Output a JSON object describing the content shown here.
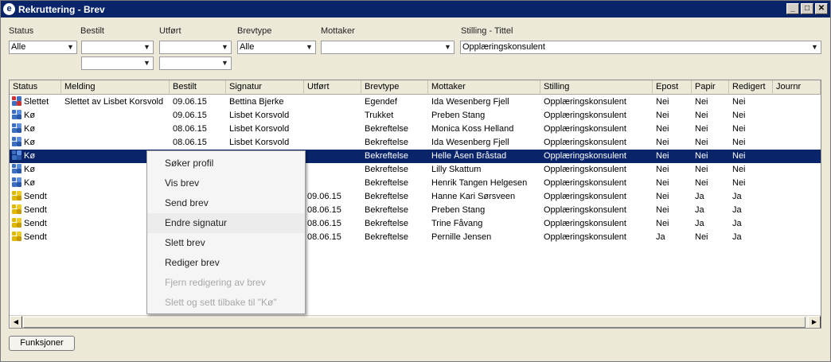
{
  "window": {
    "title": "Rekruttering - Brev",
    "app_icon_letter": "e"
  },
  "filters": {
    "status_label": "Status",
    "status_value": "Alle",
    "bestilt_label": "Bestilt",
    "utfort_label": "Utført",
    "brevtype_label": "Brevtype",
    "brevtype_value": "Alle",
    "mottaker_label": "Mottaker",
    "stilling_label": "Stilling - Tittel",
    "stilling_value": "Opplæringskonsulent"
  },
  "grid": {
    "columns": [
      "Status",
      "Melding",
      "Bestilt",
      "Signatur",
      "Utført",
      "Brevtype",
      "Mottaker",
      "Stilling",
      "Epost",
      "Papir",
      "Redigert",
      "Journr"
    ],
    "rows": [
      {
        "status": "Slettet",
        "icon": "deleted-icon",
        "melding": "Slettet av Lisbet Korsvold",
        "bestilt": "09.06.15",
        "signatur": "Bettina Bjerke",
        "utfort": "",
        "brevtype": "Egendef",
        "mottaker": "Ida Wesenberg Fjell",
        "stilling": "Opplæringskonsulent",
        "epost": "Nei",
        "papir": "Nei",
        "redigert": "Nei",
        "journr": ""
      },
      {
        "status": "Kø",
        "icon": "queue-icon",
        "melding": "",
        "bestilt": "09.06.15",
        "signatur": "Lisbet Korsvold",
        "utfort": "",
        "brevtype": "Trukket",
        "mottaker": "Preben Stang",
        "stilling": "Opplæringskonsulent",
        "epost": "Nei",
        "papir": "Nei",
        "redigert": "Nei",
        "journr": ""
      },
      {
        "status": "Kø",
        "icon": "queue-icon",
        "melding": "",
        "bestilt": "08.06.15",
        "signatur": "Lisbet Korsvold",
        "utfort": "",
        "brevtype": "Bekreftelse",
        "mottaker": "Monica Koss Helland",
        "stilling": "Opplæringskonsulent",
        "epost": "Nei",
        "papir": "Nei",
        "redigert": "Nei",
        "journr": ""
      },
      {
        "status": "Kø",
        "icon": "queue-icon",
        "melding": "",
        "bestilt": "08.06.15",
        "signatur": "Lisbet Korsvold",
        "utfort": "",
        "brevtype": "Bekreftelse",
        "mottaker": "Ida Wesenberg Fjell",
        "stilling": "Opplæringskonsulent",
        "epost": "Nei",
        "papir": "Nei",
        "redigert": "Nei",
        "journr": ""
      },
      {
        "status": "Kø",
        "icon": "queue-icon",
        "melding": "",
        "bestilt": "",
        "signatur": "",
        "utfort": "",
        "brevtype": "Bekreftelse",
        "mottaker": "Helle Åsen Bråstad",
        "stilling": "Opplæringskonsulent",
        "epost": "Nei",
        "papir": "Nei",
        "redigert": "Nei",
        "journr": ""
      },
      {
        "status": "Kø",
        "icon": "queue-icon",
        "melding": "",
        "bestilt": "",
        "signatur": "",
        "utfort": "",
        "brevtype": "Bekreftelse",
        "mottaker": "Lilly Skattum",
        "stilling": "Opplæringskonsulent",
        "epost": "Nei",
        "papir": "Nei",
        "redigert": "Nei",
        "journr": ""
      },
      {
        "status": "Kø",
        "icon": "queue-icon",
        "melding": "",
        "bestilt": "",
        "signatur": "",
        "utfort": "",
        "brevtype": "Bekreftelse",
        "mottaker": "Henrik Tangen Helgesen",
        "stilling": "Opplæringskonsulent",
        "epost": "Nei",
        "papir": "Nei",
        "redigert": "Nei",
        "journr": ""
      },
      {
        "status": "Sendt",
        "icon": "sent-icon",
        "melding": "",
        "bestilt": "",
        "signatur": "",
        "utfort": "09.06.15",
        "brevtype": "Bekreftelse",
        "mottaker": "Hanne Kari Sørsveen",
        "stilling": "Opplæringskonsulent",
        "epost": "Nei",
        "papir": "Ja",
        "redigert": "Ja",
        "journr": ""
      },
      {
        "status": "Sendt",
        "icon": "sent-icon",
        "melding": "",
        "bestilt": "",
        "signatur": "",
        "utfort": "08.06.15",
        "brevtype": "Bekreftelse",
        "mottaker": "Preben Stang",
        "stilling": "Opplæringskonsulent",
        "epost": "Nei",
        "papir": "Ja",
        "redigert": "Ja",
        "journr": ""
      },
      {
        "status": "Sendt",
        "icon": "sent-icon",
        "melding": "",
        "bestilt": "",
        "signatur": "",
        "utfort": "08.06.15",
        "brevtype": "Bekreftelse",
        "mottaker": "Trine Fåvang",
        "stilling": "Opplæringskonsulent",
        "epost": "Nei",
        "papir": "Ja",
        "redigert": "Ja",
        "journr": ""
      },
      {
        "status": "Sendt",
        "icon": "sent-icon",
        "melding": "",
        "bestilt": "",
        "signatur": "",
        "utfort": "08.06.15",
        "brevtype": "Bekreftelse",
        "mottaker": "Pernille Jensen",
        "stilling": "Opplæringskonsulent",
        "epost": "Ja",
        "papir": "Nei",
        "redigert": "Ja",
        "journr": ""
      }
    ],
    "selected_row": 4
  },
  "context_menu": {
    "items": [
      {
        "label": "Søker profil",
        "enabled": true
      },
      {
        "label": "Vis brev",
        "enabled": true
      },
      {
        "label": "Send brev",
        "enabled": true
      },
      {
        "label": "Endre signatur",
        "enabled": true,
        "hover": true
      },
      {
        "label": "Slett brev",
        "enabled": true
      },
      {
        "label": "Rediger brev",
        "enabled": true
      },
      {
        "label": "Fjern redigering av brev",
        "enabled": false
      },
      {
        "label": "Slett og sett tilbake til \"Kø\"",
        "enabled": false
      }
    ]
  },
  "footer": {
    "funksjoner_label": "Funksjoner"
  },
  "colors": {
    "titlebar": "#0a246a",
    "selection": "#0a246a",
    "window_bg": "#ece9d8"
  }
}
